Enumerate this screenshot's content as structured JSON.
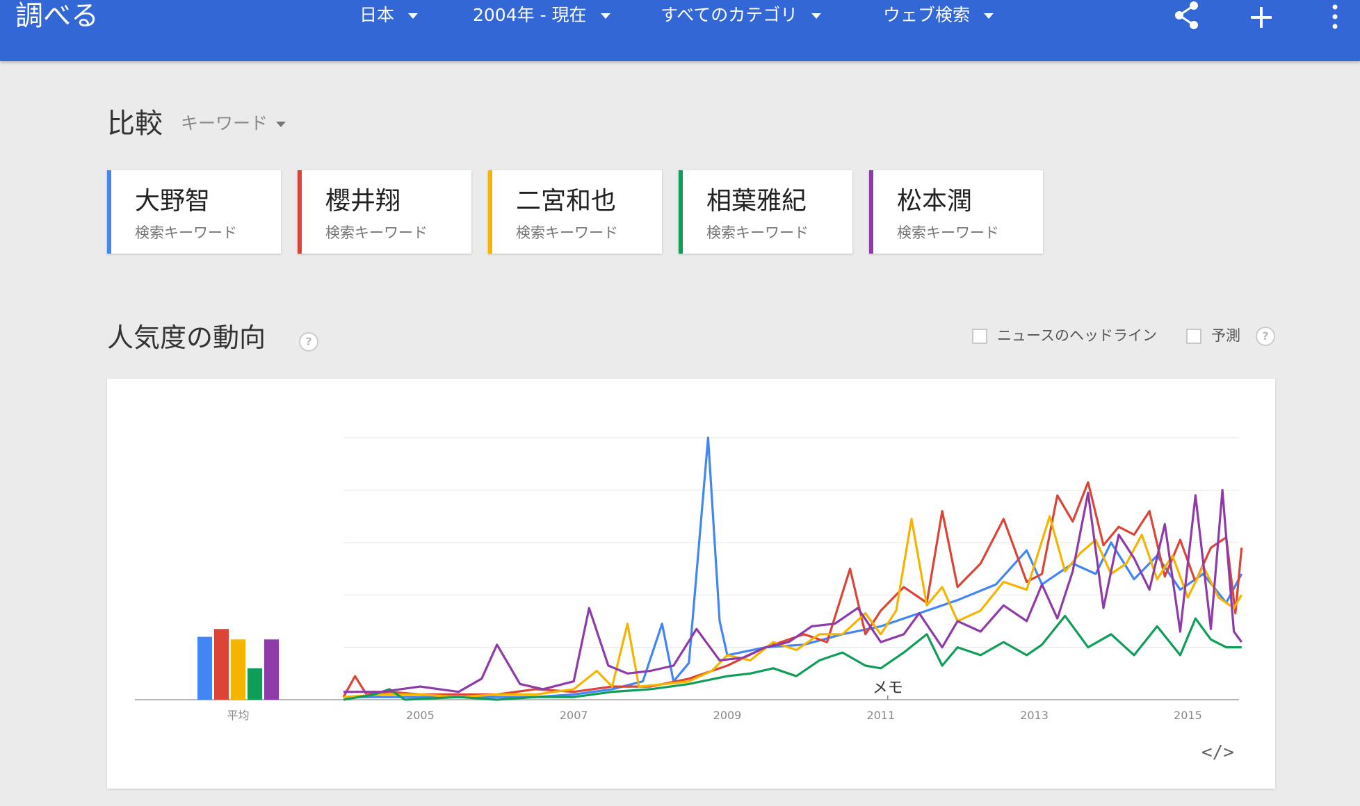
{
  "header": {
    "title": "調べる",
    "filters": [
      {
        "label": "日本"
      },
      {
        "label": "2004年 - 現在"
      },
      {
        "label": "すべてのカテゴリ"
      },
      {
        "label": "ウェブ検索"
      }
    ],
    "icons": [
      "share-icon",
      "add-icon",
      "more-vert-icon"
    ],
    "bg_color": "#3367d6"
  },
  "compare": {
    "title": "比較",
    "dropdown_label": "キーワード"
  },
  "terms": [
    {
      "name": "大野智",
      "sub": "検索キーワード",
      "color": "#4285f4"
    },
    {
      "name": "櫻井翔",
      "sub": "検索キーワード",
      "color": "#db4437"
    },
    {
      "name": "二宮和也",
      "sub": "検索キーワード",
      "color": "#f4b400"
    },
    {
      "name": "相葉雅紀",
      "sub": "検索キーワード",
      "color": "#0f9d58"
    },
    {
      "name": "松本潤",
      "sub": "検索キーワード",
      "color": "#8e3aa8"
    }
  ],
  "trend": {
    "title": "人気度の動向",
    "news_headlines_label": "ニュースのヘッドライン",
    "forecast_label": "予測",
    "help": "?",
    "embed_label": "</>"
  },
  "chart_data": {
    "type": "line",
    "x_range": [
      "2004-01",
      "2015-09"
    ],
    "ylim": [
      0,
      100
    ],
    "xlabel": "",
    "ylabel": "",
    "x_tick_labels": [
      "2005",
      "2007",
      "2009",
      "2011",
      "2013",
      "2015"
    ],
    "note_label": "メモ",
    "note_date": "2011-01",
    "average_label": "平均",
    "average_values": [
      24,
      27,
      23,
      12,
      23
    ],
    "grid": true,
    "series": [
      {
        "name": "大野智",
        "color": "#4285f4",
        "points": [
          [
            2004.0,
            1
          ],
          [
            2004.5,
            1
          ],
          [
            2005.0,
            1
          ],
          [
            2005.5,
            1
          ],
          [
            2006.0,
            1
          ],
          [
            2006.5,
            1
          ],
          [
            2007.0,
            2
          ],
          [
            2007.5,
            4
          ],
          [
            2007.9,
            7
          ],
          [
            2008.15,
            29
          ],
          [
            2008.3,
            7
          ],
          [
            2008.5,
            14
          ],
          [
            2008.75,
            100
          ],
          [
            2008.9,
            30
          ],
          [
            2009.0,
            17
          ],
          [
            2009.5,
            20
          ],
          [
            2010.0,
            21
          ],
          [
            2010.5,
            25
          ],
          [
            2011.0,
            28
          ],
          [
            2011.5,
            33
          ],
          [
            2012.0,
            38
          ],
          [
            2012.5,
            44
          ],
          [
            2012.9,
            57
          ],
          [
            2013.1,
            44
          ],
          [
            2013.5,
            52
          ],
          [
            2013.8,
            48
          ],
          [
            2014.0,
            60
          ],
          [
            2014.3,
            46
          ],
          [
            2014.6,
            55
          ],
          [
            2014.9,
            42
          ],
          [
            2015.2,
            48
          ],
          [
            2015.5,
            37
          ],
          [
            2015.7,
            48
          ]
        ]
      },
      {
        "name": "櫻井翔",
        "color": "#db4437",
        "points": [
          [
            2004.0,
            1
          ],
          [
            2004.15,
            9
          ],
          [
            2004.3,
            2
          ],
          [
            2004.6,
            3
          ],
          [
            2005.0,
            2
          ],
          [
            2005.5,
            2
          ],
          [
            2006.0,
            2
          ],
          [
            2006.5,
            4
          ],
          [
            2007.0,
            3
          ],
          [
            2007.5,
            5
          ],
          [
            2008.0,
            5
          ],
          [
            2008.5,
            8
          ],
          [
            2009.0,
            13
          ],
          [
            2009.5,
            20
          ],
          [
            2010.0,
            25
          ],
          [
            2010.3,
            22
          ],
          [
            2010.6,
            50
          ],
          [
            2010.8,
            25
          ],
          [
            2011.0,
            34
          ],
          [
            2011.3,
            43
          ],
          [
            2011.6,
            37
          ],
          [
            2011.8,
            72
          ],
          [
            2012.0,
            43
          ],
          [
            2012.3,
            52
          ],
          [
            2012.6,
            69
          ],
          [
            2012.9,
            45
          ],
          [
            2013.1,
            48
          ],
          [
            2013.3,
            78
          ],
          [
            2013.5,
            68
          ],
          [
            2013.7,
            83
          ],
          [
            2013.9,
            59
          ],
          [
            2014.1,
            66
          ],
          [
            2014.3,
            63
          ],
          [
            2014.5,
            72
          ],
          [
            2014.7,
            47
          ],
          [
            2014.9,
            61
          ],
          [
            2015.1,
            45
          ],
          [
            2015.3,
            58
          ],
          [
            2015.5,
            62
          ],
          [
            2015.62,
            33
          ],
          [
            2015.7,
            58
          ]
        ]
      },
      {
        "name": "二宮和也",
        "color": "#f4b400",
        "points": [
          [
            2004.0,
            1
          ],
          [
            2004.5,
            2
          ],
          [
            2005.0,
            2
          ],
          [
            2005.5,
            1
          ],
          [
            2006.0,
            2
          ],
          [
            2006.5,
            2
          ],
          [
            2007.0,
            4
          ],
          [
            2007.3,
            11
          ],
          [
            2007.5,
            5
          ],
          [
            2007.7,
            29
          ],
          [
            2007.85,
            5
          ],
          [
            2008.2,
            6
          ],
          [
            2008.5,
            7
          ],
          [
            2008.8,
            11
          ],
          [
            2009.0,
            17
          ],
          [
            2009.3,
            15
          ],
          [
            2009.6,
            22
          ],
          [
            2009.9,
            19
          ],
          [
            2010.2,
            25
          ],
          [
            2010.5,
            25
          ],
          [
            2010.8,
            33
          ],
          [
            2011.0,
            25
          ],
          [
            2011.2,
            34
          ],
          [
            2011.4,
            69
          ],
          [
            2011.6,
            36
          ],
          [
            2011.8,
            43
          ],
          [
            2012.0,
            30
          ],
          [
            2012.3,
            34
          ],
          [
            2012.6,
            45
          ],
          [
            2012.9,
            42
          ],
          [
            2013.2,
            70
          ],
          [
            2013.4,
            49
          ],
          [
            2013.6,
            56
          ],
          [
            2013.8,
            61
          ],
          [
            2014.0,
            48
          ],
          [
            2014.2,
            52
          ],
          [
            2014.4,
            63
          ],
          [
            2014.6,
            46
          ],
          [
            2014.8,
            55
          ],
          [
            2015.0,
            39
          ],
          [
            2015.2,
            51
          ],
          [
            2015.4,
            39
          ],
          [
            2015.6,
            35
          ],
          [
            2015.7,
            40
          ]
        ]
      },
      {
        "name": "相葉雅紀",
        "color": "#0f9d58",
        "points": [
          [
            2004.0,
            0
          ],
          [
            2004.4,
            2
          ],
          [
            2004.6,
            4
          ],
          [
            2004.8,
            0
          ],
          [
            2005.5,
            1
          ],
          [
            2006.0,
            0
          ],
          [
            2006.5,
            1
          ],
          [
            2007.0,
            1
          ],
          [
            2007.5,
            3
          ],
          [
            2008.0,
            4
          ],
          [
            2008.5,
            6
          ],
          [
            2009.0,
            9
          ],
          [
            2009.3,
            10
          ],
          [
            2009.6,
            12
          ],
          [
            2009.9,
            9
          ],
          [
            2010.2,
            15
          ],
          [
            2010.5,
            18
          ],
          [
            2010.8,
            13
          ],
          [
            2011.0,
            12
          ],
          [
            2011.3,
            18
          ],
          [
            2011.6,
            25
          ],
          [
            2011.8,
            13
          ],
          [
            2012.0,
            20
          ],
          [
            2012.3,
            17
          ],
          [
            2012.6,
            22
          ],
          [
            2012.9,
            17
          ],
          [
            2013.1,
            21
          ],
          [
            2013.4,
            32
          ],
          [
            2013.7,
            20
          ],
          [
            2014.0,
            25
          ],
          [
            2014.3,
            17
          ],
          [
            2014.6,
            28
          ],
          [
            2014.9,
            17
          ],
          [
            2015.1,
            31
          ],
          [
            2015.3,
            23
          ],
          [
            2015.5,
            20
          ],
          [
            2015.7,
            20
          ]
        ]
      },
      {
        "name": "松本潤",
        "color": "#8e3aa8",
        "points": [
          [
            2004.0,
            3
          ],
          [
            2004.5,
            3
          ],
          [
            2005.0,
            5
          ],
          [
            2005.5,
            3
          ],
          [
            2005.8,
            8
          ],
          [
            2006.0,
            21
          ],
          [
            2006.3,
            6
          ],
          [
            2006.6,
            4
          ],
          [
            2007.0,
            7
          ],
          [
            2007.2,
            35
          ],
          [
            2007.45,
            13
          ],
          [
            2007.7,
            10
          ],
          [
            2008.0,
            11
          ],
          [
            2008.3,
            13
          ],
          [
            2008.6,
            27
          ],
          [
            2008.9,
            15
          ],
          [
            2009.2,
            16
          ],
          [
            2009.5,
            20
          ],
          [
            2009.8,
            22
          ],
          [
            2010.1,
            28
          ],
          [
            2010.4,
            29
          ],
          [
            2010.7,
            35
          ],
          [
            2011.0,
            22
          ],
          [
            2011.3,
            25
          ],
          [
            2011.5,
            33
          ],
          [
            2011.8,
            20
          ],
          [
            2012.0,
            30
          ],
          [
            2012.3,
            26
          ],
          [
            2012.6,
            36
          ],
          [
            2012.9,
            30
          ],
          [
            2013.1,
            44
          ],
          [
            2013.3,
            31
          ],
          [
            2013.5,
            49
          ],
          [
            2013.7,
            79
          ],
          [
            2013.9,
            35
          ],
          [
            2014.1,
            63
          ],
          [
            2014.3,
            54
          ],
          [
            2014.5,
            42
          ],
          [
            2014.7,
            67
          ],
          [
            2014.9,
            26
          ],
          [
            2015.1,
            78
          ],
          [
            2015.3,
            27
          ],
          [
            2015.45,
            80
          ],
          [
            2015.6,
            26
          ],
          [
            2015.7,
            22
          ]
        ]
      }
    ]
  }
}
